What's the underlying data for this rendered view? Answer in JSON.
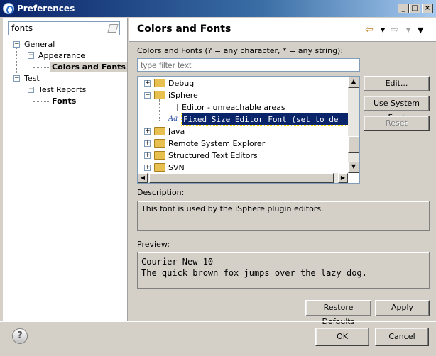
{
  "window": {
    "title": "Preferences"
  },
  "search": {
    "value": "fonts"
  },
  "nav_tree": [
    {
      "label": "General"
    },
    {
      "label": "Appearance"
    },
    {
      "label": "Colors and Fonts"
    },
    {
      "label": "Test"
    },
    {
      "label": "Test Reports"
    },
    {
      "label": "Fonts"
    }
  ],
  "page": {
    "title": "Colors and Fonts",
    "filter_label": "Colors and Fonts (? = any character, * = any string):",
    "filter_placeholder": "type filter text"
  },
  "font_tree": [
    {
      "label": "Debug",
      "expand": "+"
    },
    {
      "label": "iSphere",
      "expand": "−"
    },
    {
      "label": "Editor - unreachable areas"
    },
    {
      "label": "Fixed Size Editor Font (set to de"
    },
    {
      "label": "Java",
      "expand": "+"
    },
    {
      "label": "Remote System Explorer",
      "expand": "+"
    },
    {
      "label": "Structured Text Editors",
      "expand": "+"
    },
    {
      "label": "SVN",
      "expand": "+"
    }
  ],
  "buttons": {
    "edit": "Edit...",
    "use_system_font": "Use System Font",
    "reset": "Reset",
    "restore_defaults": "Restore Defaults",
    "apply": "Apply",
    "ok": "OK",
    "cancel": "Cancel"
  },
  "description": {
    "label": "Description:",
    "text": "This font is used by the iSphere plugin editors."
  },
  "preview": {
    "label": "Preview:",
    "line1": "Courier New 10",
    "line2": "The quick brown fox jumps over the lazy dog."
  },
  "icons": {
    "app": "eclipse-icon",
    "help": "help-icon",
    "nav_back": "back-arrow-icon",
    "nav_forward": "forward-arrow-icon",
    "menu": "view-menu-icon"
  }
}
